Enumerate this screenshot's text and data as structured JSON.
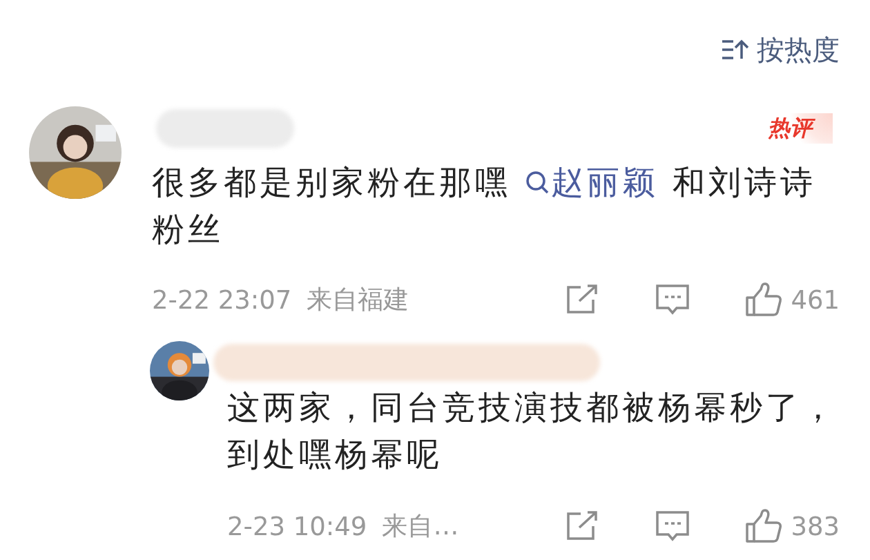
{
  "sort": {
    "label": "按热度"
  },
  "comments": [
    {
      "badge": "热评",
      "segments": [
        {
          "kind": "text",
          "text": "很多都是别家粉在那嘿 "
        },
        {
          "kind": "topic",
          "text": "赵丽颖"
        },
        {
          "kind": "text",
          "text": " 和刘诗诗粉丝"
        }
      ],
      "time": "2-22 23:07",
      "location": "来自福建",
      "likes": "461",
      "replies": [
        {
          "segments": [
            {
              "kind": "text",
              "text": "这两家，同台竞技演技都被杨幂秒了，到处嘿杨幂呢"
            }
          ],
          "time": "2-23 10:49",
          "location": "来自…",
          "likes": "383"
        }
      ]
    }
  ]
}
